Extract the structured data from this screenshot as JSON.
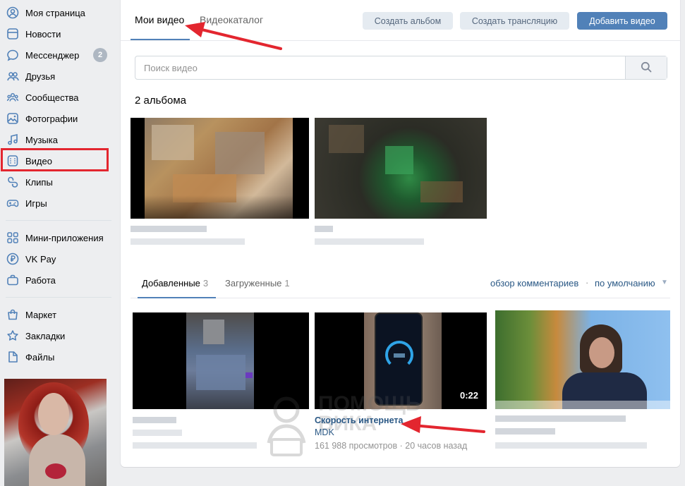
{
  "sidebar": {
    "items": [
      {
        "label": "Моя страница",
        "icon": "user-circle-icon"
      },
      {
        "label": "Новости",
        "icon": "news-icon"
      },
      {
        "label": "Мессенджер",
        "icon": "chat-bubble-icon",
        "badge": "2"
      },
      {
        "label": "Друзья",
        "icon": "friends-icon"
      },
      {
        "label": "Сообщества",
        "icon": "communities-icon"
      },
      {
        "label": "Фотографии",
        "icon": "photo-icon"
      },
      {
        "label": "Музыка",
        "icon": "music-note-icon"
      },
      {
        "label": "Видео",
        "icon": "video-icon",
        "highlighted": true
      },
      {
        "label": "Клипы",
        "icon": "clips-icon"
      },
      {
        "label": "Игры",
        "icon": "gamepad-icon"
      },
      {
        "label": "Мини-приложения",
        "icon": "apps-icon"
      },
      {
        "label": "VK Pay",
        "icon": "ruble-icon"
      },
      {
        "label": "Работа",
        "icon": "briefcase-icon"
      },
      {
        "label": "Маркет",
        "icon": "shopping-bag-icon"
      },
      {
        "label": "Закладки",
        "icon": "star-icon"
      },
      {
        "label": "Файлы",
        "icon": "file-icon"
      }
    ]
  },
  "header": {
    "tabs": [
      {
        "label": "Мои видео",
        "active": true
      },
      {
        "label": "Видеокаталог",
        "active": false
      }
    ],
    "buttons": {
      "create_album": "Создать альбом",
      "create_stream": "Создать трансляцию",
      "add_video": "Добавить видео"
    }
  },
  "search": {
    "placeholder": "Поиск видео",
    "icon": "search-icon"
  },
  "albums": {
    "title": "2 альбома"
  },
  "videos_tabs": {
    "added": {
      "label": "Добавленные",
      "count": "3"
    },
    "uploaded": {
      "label": "Загруженные",
      "count": "1"
    },
    "comments_link": "обзор комментариев",
    "separator": "·",
    "sort": "по умолчанию"
  },
  "videos": [
    {
      "title": "",
      "duration": ""
    },
    {
      "title": "Скорость интернета",
      "author": "MDK",
      "views": "161 988 просмотров",
      "separator": "·",
      "time": "20 часов назад",
      "duration": "0:22"
    },
    {
      "title": "",
      "duration": ""
    }
  ],
  "watermark": {
    "line1": "ПОМОЩЬ",
    "line2": "ВИКА"
  },
  "colors": {
    "accent": "#5181b8",
    "annotation": "#e3262f",
    "link": "#2a5885"
  }
}
